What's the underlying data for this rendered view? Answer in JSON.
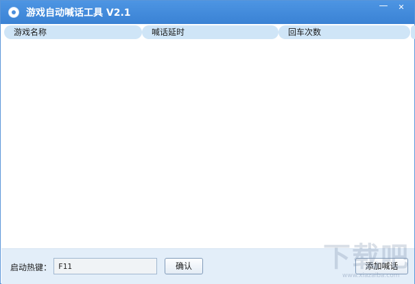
{
  "window": {
    "title": "游戏自动喊话工具 V2.1",
    "minimize_label": "—",
    "close_label": "✕"
  },
  "list": {
    "columns": [
      "游戏名称",
      "喊话延时",
      "回车次数",
      ""
    ],
    "rows": []
  },
  "bottom": {
    "hotkey_label": "启动热键：",
    "hotkey_value": "F11",
    "confirm_label": "确认",
    "add_label": "添加喊话"
  },
  "watermark": {
    "text": "下载吧",
    "url": "www.xiazaiba.com"
  },
  "colors": {
    "titlebar": "#3f89da",
    "header_pill": "#cfe5f7",
    "bottom_bar": "#e3eef9"
  },
  "icons": {
    "app": "disc-app-icon",
    "minimize": "minimize-icon",
    "close": "close-icon"
  }
}
